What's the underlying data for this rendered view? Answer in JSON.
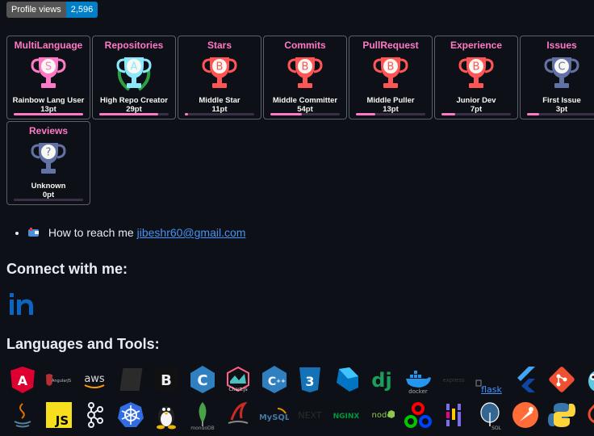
{
  "profile_views": {
    "label": "Profile views",
    "count": "2,596"
  },
  "trophies": [
    {
      "category": "MultiLanguage",
      "rank": "S",
      "title": "Rainbow Lang User",
      "points": "13pt",
      "progress": 1.0,
      "cup_color": "#ff79c6",
      "laurel": false
    },
    {
      "category": "Repositories",
      "rank": "A",
      "title": "High Repo Creator",
      "points": "29pt",
      "progress": 0.85,
      "cup_color": "#8be9fd",
      "laurel": true
    },
    {
      "category": "Stars",
      "rank": "B",
      "title": "Middle Star",
      "points": "11pt",
      "progress": 0.05,
      "cup_color": "#ff5555",
      "laurel": false
    },
    {
      "category": "Commits",
      "rank": "B",
      "title": "Middle Committer",
      "points": "54pt",
      "progress": 0.45,
      "cup_color": "#ff5555",
      "laurel": false
    },
    {
      "category": "PullRequest",
      "rank": "B",
      "title": "Middle Puller",
      "points": "13pt",
      "progress": 0.28,
      "cup_color": "#ff5555",
      "laurel": false
    },
    {
      "category": "Experience",
      "rank": "B",
      "title": "Junior Dev",
      "points": "7pt",
      "progress": 0.2,
      "cup_color": "#ff5555",
      "laurel": false
    },
    {
      "category": "Issues",
      "rank": "C",
      "title": "First Issue",
      "points": "3pt",
      "progress": 0.18,
      "cup_color": "#6272a4",
      "laurel": false
    },
    {
      "category": "Reviews",
      "rank": "?",
      "title": "Unknown",
      "points": "0pt",
      "progress": 0.0,
      "cup_color": "#6272a4",
      "laurel": false
    }
  ],
  "reach": {
    "text": "How to reach me",
    "email": "jibeshr60@gmail.com"
  },
  "connect_heading": "Connect with me:",
  "social": {
    "linkedin_text": "in",
    "linkedin_color": "#0a66c2"
  },
  "tools_heading": "Languages and Tools:",
  "tools_row1": [
    {
      "name": "angular-icon",
      "text": "A",
      "color": "#dd0031"
    },
    {
      "name": "angularjs-icon",
      "text": "AngularJS",
      "color": "#b52e31"
    },
    {
      "name": "aws-icon",
      "text": "aws",
      "color": "#ff9900"
    },
    {
      "name": "babel-icon",
      "text": "",
      "color": "#2b2b2b"
    },
    {
      "name": "bootstrap-icon",
      "text": "B",
      "color": "#111111"
    },
    {
      "name": "c-icon",
      "text": "C",
      "color": "#2f7fc1"
    },
    {
      "name": "chartjs-icon",
      "text": "Chart.js",
      "color": "#ff6384"
    },
    {
      "name": "cplusplus-icon",
      "text": "C++",
      "color": "#2f7fc1"
    },
    {
      "name": "css3-icon",
      "text": "3",
      "color": "#1572b6"
    },
    {
      "name": "dart-icon",
      "text": "",
      "color": "#0175c2"
    },
    {
      "name": "django-icon",
      "text": "dj",
      "color": "#1b9e5a"
    },
    {
      "name": "docker-icon",
      "text": "docker",
      "color": "#2496ed"
    },
    {
      "name": "express-icon",
      "text": "express",
      "color": "#3a3a3a"
    },
    {
      "name": "flask-icon",
      "text": "flask",
      "color": "#4493f8"
    },
    {
      "name": "flutter-icon",
      "text": "",
      "color": "#02569b"
    },
    {
      "name": "git-icon",
      "text": "",
      "color": "#f05032"
    },
    {
      "name": "go-icon",
      "text": "",
      "color": "#5fc9e3"
    }
  ],
  "tools_row2": [
    {
      "name": "java-icon",
      "text": "",
      "color": "#e76f00"
    },
    {
      "name": "javascript-icon",
      "text": "JS",
      "color": "#f7df1e"
    },
    {
      "name": "kafka-icon",
      "text": "",
      "color": "#e6edf3"
    },
    {
      "name": "kubernetes-icon",
      "text": "",
      "color": "#326ce5"
    },
    {
      "name": "linux-icon",
      "text": "",
      "color": "#f5f5f5"
    },
    {
      "name": "mongodb-icon",
      "text": "mongoDB",
      "color": "#47a248"
    },
    {
      "name": "mssql-icon",
      "text": "",
      "color": "#cc2927"
    },
    {
      "name": "mysql-icon",
      "text": "MySQL",
      "color": "#4479a1"
    },
    {
      "name": "nextjs-icon",
      "text": "NEXT",
      "color": "#2b2b2b"
    },
    {
      "name": "nginx-icon",
      "text": "NGINX",
      "color": "#009639"
    },
    {
      "name": "nodejs-icon",
      "text": "node",
      "color": "#8cc84b"
    },
    {
      "name": "opencv-icon",
      "text": "",
      "color": "#ff0000"
    },
    {
      "name": "pandas-icon",
      "text": "",
      "color": "#150458"
    },
    {
      "name": "postgresql-icon",
      "text": "SQL",
      "color": "#336791"
    },
    {
      "name": "postman-icon",
      "text": "",
      "color": "#ff6c37"
    },
    {
      "name": "python-icon",
      "text": "",
      "color": "#3776ab"
    },
    {
      "name": "pytorch-icon",
      "text": "",
      "color": "#ee4c2c"
    }
  ]
}
